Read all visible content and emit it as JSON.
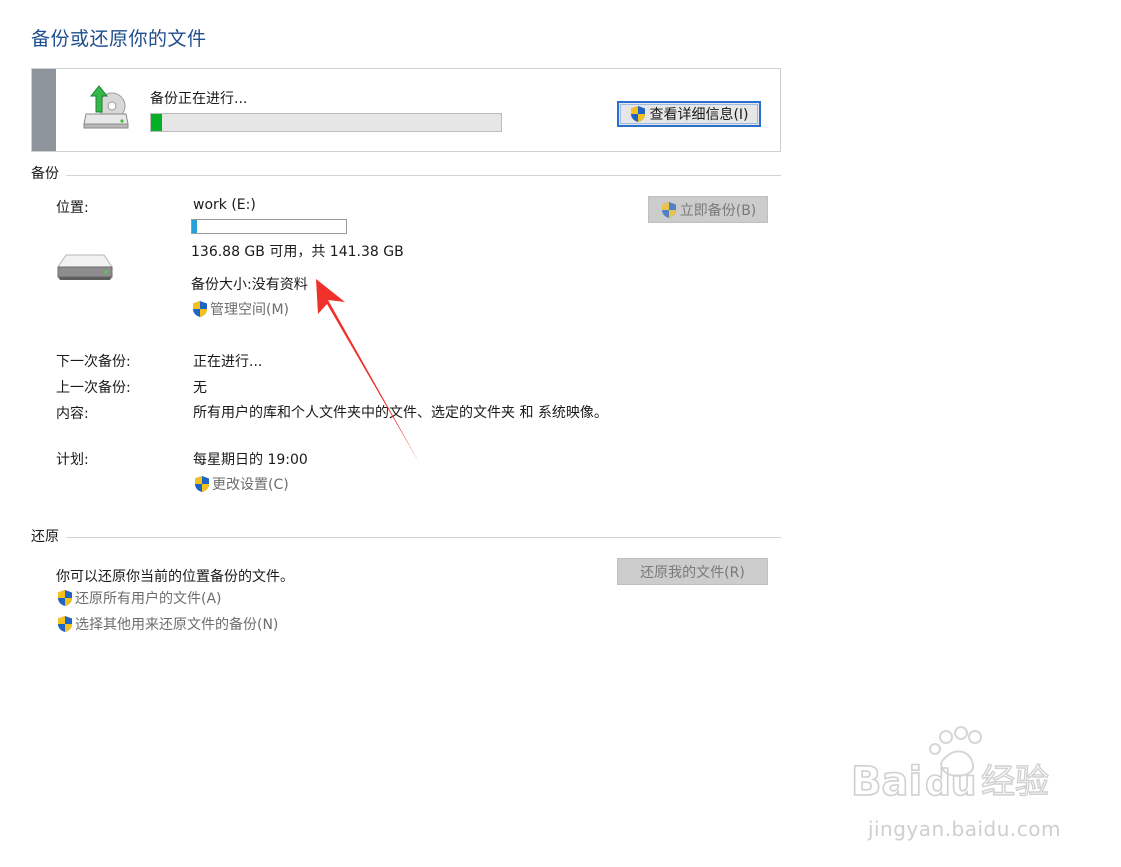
{
  "page": {
    "title": "备份或还原你的文件"
  },
  "progress": {
    "label": "备份正在进行...",
    "fraction": 0.03,
    "details_button": "查看详细信息(I)"
  },
  "backup": {
    "section_label": "备份",
    "location_label": "位置:",
    "drive_name": "work (E:)",
    "drive_used_fraction": 0.032,
    "space_text": "136.88 GB 可用，共 141.38 GB",
    "backup_size_text": "备份大小:没有资料",
    "manage_space_link": "管理空间(M)",
    "backup_now_button": "立即备份(B)",
    "rows": [
      {
        "label": "下一次备份:",
        "value": "正在进行..."
      },
      {
        "label": "上一次备份:",
        "value": "无"
      },
      {
        "label": "内容:",
        "value": "所有用户的库和个人文件夹中的文件、选定的文件夹 和 系统映像。"
      },
      {
        "label": "计划:",
        "value": "每星期日的 19:00"
      }
    ],
    "change_settings_link": "更改设置(C)"
  },
  "restore": {
    "section_label": "还原",
    "description": "你可以还原你当前的位置备份的文件。",
    "restore_button": "还原我的文件(R)",
    "links": [
      "还原所有用户的文件(A)",
      "选择其他用来还原文件的备份(N)"
    ]
  },
  "annotation": {
    "color": "#f0302a"
  },
  "watermark": {
    "brand_logo_text": "Bai du 经验",
    "url": "jingyan.baidu.com"
  },
  "colors": {
    "title": "#1e4e8c",
    "progress_green": "#06b025",
    "usage_blue": "#26a0da",
    "link_gray": "#6d6d6d"
  }
}
